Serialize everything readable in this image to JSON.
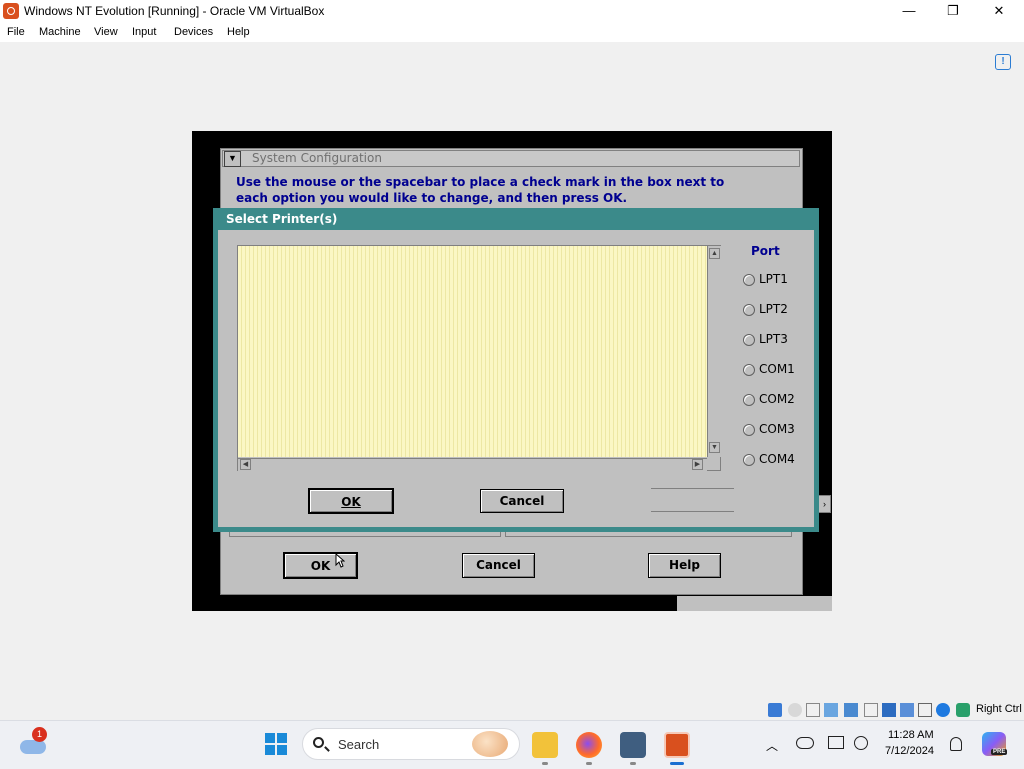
{
  "window": {
    "title": "Windows NT Evolution [Running] - Oracle VM VirtualBox",
    "minimize_glyph": "—",
    "maximize_glyph": "❐",
    "close_glyph": "✕"
  },
  "menubar": {
    "items": [
      "File",
      "Machine",
      "View",
      "Input",
      "Devices",
      "Help"
    ]
  },
  "guest": {
    "system_config": {
      "title": "System Configuration",
      "instructions": "Use the mouse or the spacebar to place a check mark in the box next to each option you would like to change, and then press OK.",
      "buttons": {
        "ok": "OK",
        "cancel": "Cancel",
        "help": "Help"
      }
    },
    "select_printer": {
      "title": "Select Printer(s)",
      "port_label": "Port",
      "ports": [
        "LPT1",
        "LPT2",
        "LPT3",
        "COM1",
        "COM2",
        "COM3",
        "COM4"
      ],
      "buttons": {
        "ok": "OK",
        "cancel": "Cancel"
      }
    }
  },
  "vbox_status": {
    "host_key": "Right Ctrl"
  },
  "taskbar": {
    "weather_badge": "1",
    "search_placeholder": "Search",
    "clock_time": "11:28 AM",
    "clock_date": "7/12/2024",
    "copilot_badge": "PRE"
  },
  "icons": {
    "app": "virtualbox-icon",
    "notification": "info-notice-icon",
    "start": "windows-start-icon",
    "search": "search-icon",
    "apps": [
      "file-explorer-icon",
      "firefox-icon",
      "virtualbox-manager-icon",
      "virtualbox-vm-icon"
    ]
  },
  "colors": {
    "dialog_frame": "#3b8a8a",
    "list_background": "#fbf7c4",
    "instruction_text": "#000090",
    "guest_grey": "#c0c0c0"
  }
}
